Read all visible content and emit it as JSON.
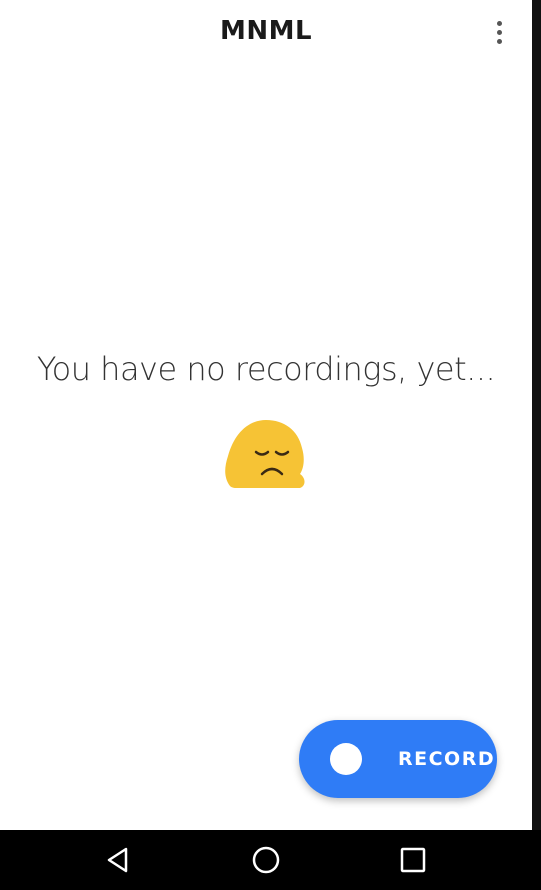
{
  "app": {
    "title": "MNML"
  },
  "toolbar": {
    "menu_icon": "more-vert-icon"
  },
  "empty_state": {
    "message": "You have no recordings, yet...",
    "emoji_icon": "disappointed-face-emoji"
  },
  "fab": {
    "label": "RECORD",
    "color": "#2f7cf6",
    "icon": "record-dot-icon"
  },
  "navbar": {
    "back_icon": "back-triangle-icon",
    "home_icon": "home-circle-icon",
    "recents_icon": "recents-square-icon"
  }
}
